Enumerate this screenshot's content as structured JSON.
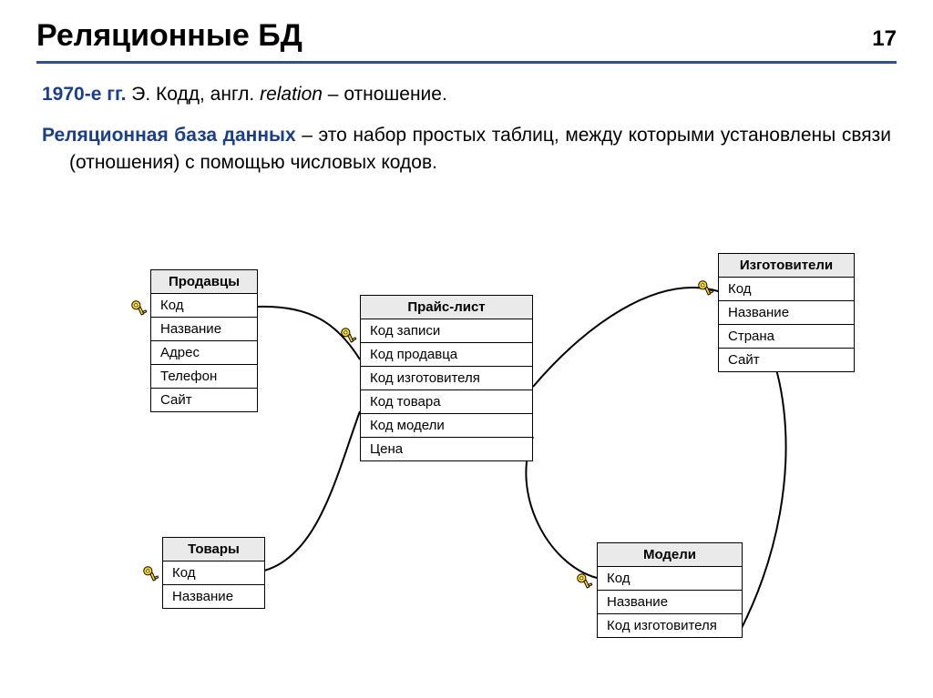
{
  "page": {
    "title": "Реляционные БД",
    "number": "17"
  },
  "intro": {
    "year": "1970-е гг.",
    "rest": " Э. Кодд, англ. ",
    "italic": "relation",
    "tail": " – отношение."
  },
  "definition": {
    "term": "Реляционная база данных",
    "text": " – это набор простых таблиц, между которыми установлены связи (отношения) с помощью числовых кодов."
  },
  "entities": {
    "sellers": {
      "title": "Продавцы",
      "rows": [
        "Код",
        "Название",
        "Адрес",
        "Телефон",
        "Сайт"
      ]
    },
    "pricelist": {
      "title": "Прайс-лист",
      "rows": [
        "Код записи",
        "Код продавца",
        "Код изготовителя",
        "Код товара",
        "Код модели",
        "Цена"
      ]
    },
    "makers": {
      "title": "Изготовители",
      "rows": [
        "Код",
        "Название",
        "Страна",
        "Сайт"
      ]
    },
    "goods": {
      "title": "Товары",
      "rows": [
        "Код",
        "Название"
      ]
    },
    "models": {
      "title": "Модели",
      "rows": [
        "Код",
        "Название",
        "Код изготовителя"
      ]
    }
  }
}
